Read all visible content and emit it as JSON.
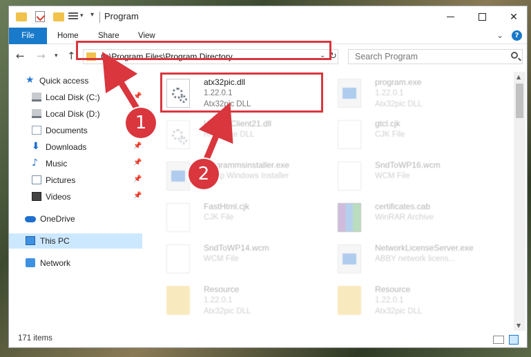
{
  "window": {
    "title": "Program",
    "controls": {
      "minimize": "—",
      "maximize": "☐",
      "close": "✕"
    }
  },
  "quick_access_toolbar": {
    "icons": [
      "folder-icon",
      "properties-icon",
      "new-folder-icon",
      "list-icon",
      "dropdown-icon"
    ]
  },
  "ribbon": {
    "tabs": [
      {
        "label": "File",
        "active": true
      },
      {
        "label": "Home"
      },
      {
        "label": "Share"
      },
      {
        "label": "View"
      }
    ],
    "expand_icon": "chevron-down-icon",
    "help_label": "?"
  },
  "navigation": {
    "address": "C:\\Program Files\\Program Directory",
    "search_placeholder": "Search Program"
  },
  "sidebar": {
    "items": [
      {
        "label": "Quick access",
        "icon": "star-icon",
        "pinned": false
      },
      {
        "label": "Local Disk (C:)",
        "icon": "disk-icon",
        "pinned": true
      },
      {
        "label": "Local Disk (D:)",
        "icon": "disk-icon",
        "pinned": false
      },
      {
        "label": "Documents",
        "icon": "documents-icon",
        "pinned": false
      },
      {
        "label": "Downloads",
        "icon": "download-icon",
        "pinned": true
      },
      {
        "label": "Music",
        "icon": "music-icon",
        "pinned": true
      },
      {
        "label": "Pictures",
        "icon": "pictures-icon",
        "pinned": true
      },
      {
        "label": "Videos",
        "icon": "videos-icon",
        "pinned": true
      },
      {
        "label": "OneDrive",
        "icon": "cloud-icon",
        "pinned": false
      },
      {
        "label": "This PC",
        "icon": "computer-icon",
        "pinned": false,
        "selected": true
      },
      {
        "label": "Network",
        "icon": "network-icon",
        "pinned": false
      }
    ]
  },
  "files": [
    {
      "name": "atx32pic.dll",
      "line1": "1.22.0.1",
      "line2": "Atx32pic DLL",
      "icon": "dll-gear-icon",
      "highlighted": true
    },
    {
      "name": "program.exe",
      "line1": "1.22.0.1",
      "line2": "Atx32pic DLL",
      "icon": "exe-icon"
    },
    {
      "name": "UpdateClient21.dll",
      "line1": "Resource DLL",
      "line2": "",
      "icon": "dll-gear-icon"
    },
    {
      "name": "gtcl.cjk",
      "line1": "CJK File",
      "line2": "",
      "icon": "file-icon"
    },
    {
      "name": "programmsinstaller.exe",
      "line1": "Setup Windows Installer",
      "line2": "",
      "icon": "exe-icon"
    },
    {
      "name": "SndToWP16.wcm",
      "line1": "WCM File",
      "line2": "",
      "icon": "file-icon"
    },
    {
      "name": "FastHtml.cjk",
      "line1": "CJK File",
      "line2": "",
      "icon": "file-icon"
    },
    {
      "name": "certificates.cab",
      "line1": "WinRAR Archive",
      "line2": "",
      "icon": "archive-icon"
    },
    {
      "name": "SndToWP14.wcm",
      "line1": "WCM File",
      "line2": "",
      "icon": "file-icon"
    },
    {
      "name": "NetworkLicenseServer.exe",
      "line1": "ABBY network licens...",
      "line2": "",
      "icon": "exe-icon"
    },
    {
      "name": "Resource",
      "line1": "1.22.0.1",
      "line2": "Atx32pic DLL",
      "icon": "folder-dll-icon"
    },
    {
      "name": "Resource",
      "line1": "1.22.0.1",
      "line2": "Atx32pic DLL",
      "icon": "folder-dll-icon"
    }
  ],
  "status": {
    "item_count": "171 items"
  },
  "annotations": {
    "step1": "1",
    "step2": "2",
    "highlight_color": "#d9363e"
  }
}
